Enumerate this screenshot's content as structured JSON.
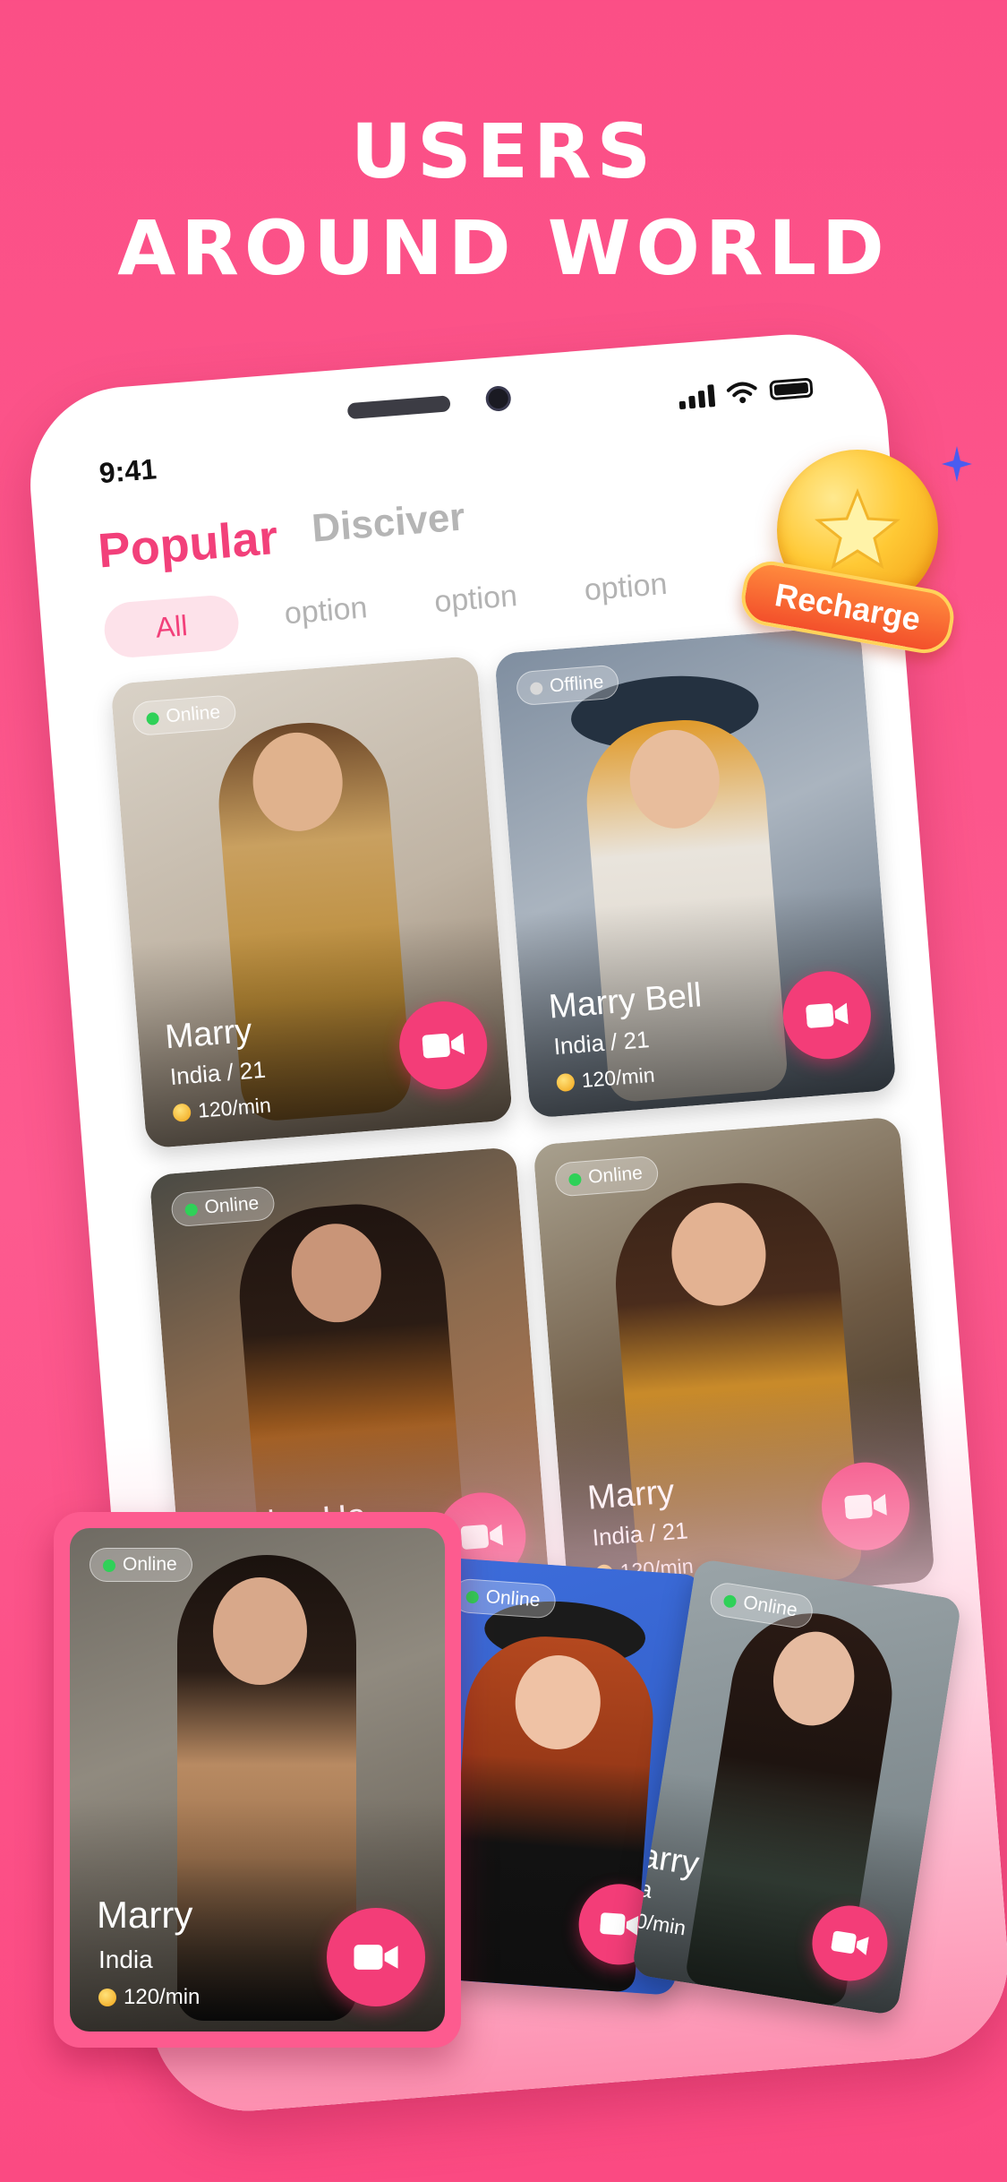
{
  "headline": {
    "line1": "Users",
    "line2": "around world"
  },
  "status_bar": {
    "time": "9:41"
  },
  "tabs": {
    "popular": "Popular",
    "discover": "Disciver"
  },
  "filters": {
    "all": "All",
    "options": [
      "option",
      "option",
      "option"
    ]
  },
  "recharge": {
    "label": "Recharge"
  },
  "cards": [
    {
      "status": "Online",
      "name": "Marry",
      "location": "India / 21",
      "rate": "120/min"
    },
    {
      "status": "Offline",
      "name": "Marry Bell",
      "location": "India / 21",
      "rate": "120/min"
    },
    {
      "status": "Online",
      "name": "Jayden Ha...",
      "location": "",
      "rate": ""
    },
    {
      "status": "Online",
      "name": "Marry",
      "location": "India / 21",
      "rate": "120/min"
    }
  ],
  "front_card": {
    "status": "Online",
    "name": "Marry",
    "location": "India",
    "rate": "120/min"
  },
  "stack_cards": [
    {
      "status": "Online",
      "name": "",
      "location": "",
      "rate": ""
    },
    {
      "status": "Online",
      "name": "arry",
      "location": "a",
      "rate": "0/min"
    }
  ],
  "colors": {
    "accent": "#f33d78",
    "background": "#fb4f86",
    "online": "#2fd158",
    "offline": "#d9d9d9"
  }
}
